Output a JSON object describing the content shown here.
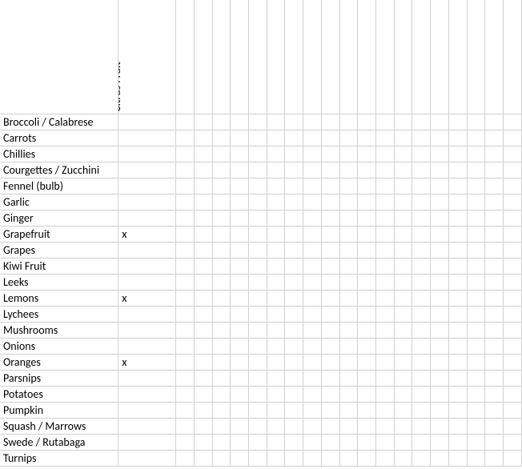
{
  "columns": [
    "Citrus Fruit"
  ],
  "extra_columns": 19,
  "rows": [
    {
      "label": "Broccoli / Calabrese",
      "values": [
        ""
      ]
    },
    {
      "label": "Carrots",
      "values": [
        ""
      ]
    },
    {
      "label": "Chillies",
      "values": [
        ""
      ]
    },
    {
      "label": "Courgettes / Zucchini",
      "values": [
        ""
      ]
    },
    {
      "label": "Fennel (bulb)",
      "values": [
        ""
      ]
    },
    {
      "label": "Garlic",
      "values": [
        ""
      ]
    },
    {
      "label": "Ginger",
      "values": [
        ""
      ]
    },
    {
      "label": "Grapefruit",
      "values": [
        "x"
      ]
    },
    {
      "label": "Grapes",
      "values": [
        ""
      ]
    },
    {
      "label": "Kiwi Fruit",
      "values": [
        ""
      ]
    },
    {
      "label": "Leeks",
      "values": [
        ""
      ]
    },
    {
      "label": "Lemons",
      "values": [
        "x"
      ]
    },
    {
      "label": "Lychees",
      "values": [
        ""
      ]
    },
    {
      "label": "Mushrooms",
      "values": [
        ""
      ]
    },
    {
      "label": "Onions",
      "values": [
        ""
      ]
    },
    {
      "label": "Oranges",
      "values": [
        "x"
      ]
    },
    {
      "label": "Parsnips",
      "values": [
        ""
      ]
    },
    {
      "label": "Potatoes",
      "values": [
        ""
      ]
    },
    {
      "label": "Pumpkin",
      "values": [
        ""
      ]
    },
    {
      "label": "Squash / Marrows",
      "values": [
        ""
      ]
    },
    {
      "label": "Swede / Rutabaga",
      "values": [
        ""
      ]
    },
    {
      "label": "Turnips",
      "values": [
        ""
      ]
    }
  ]
}
